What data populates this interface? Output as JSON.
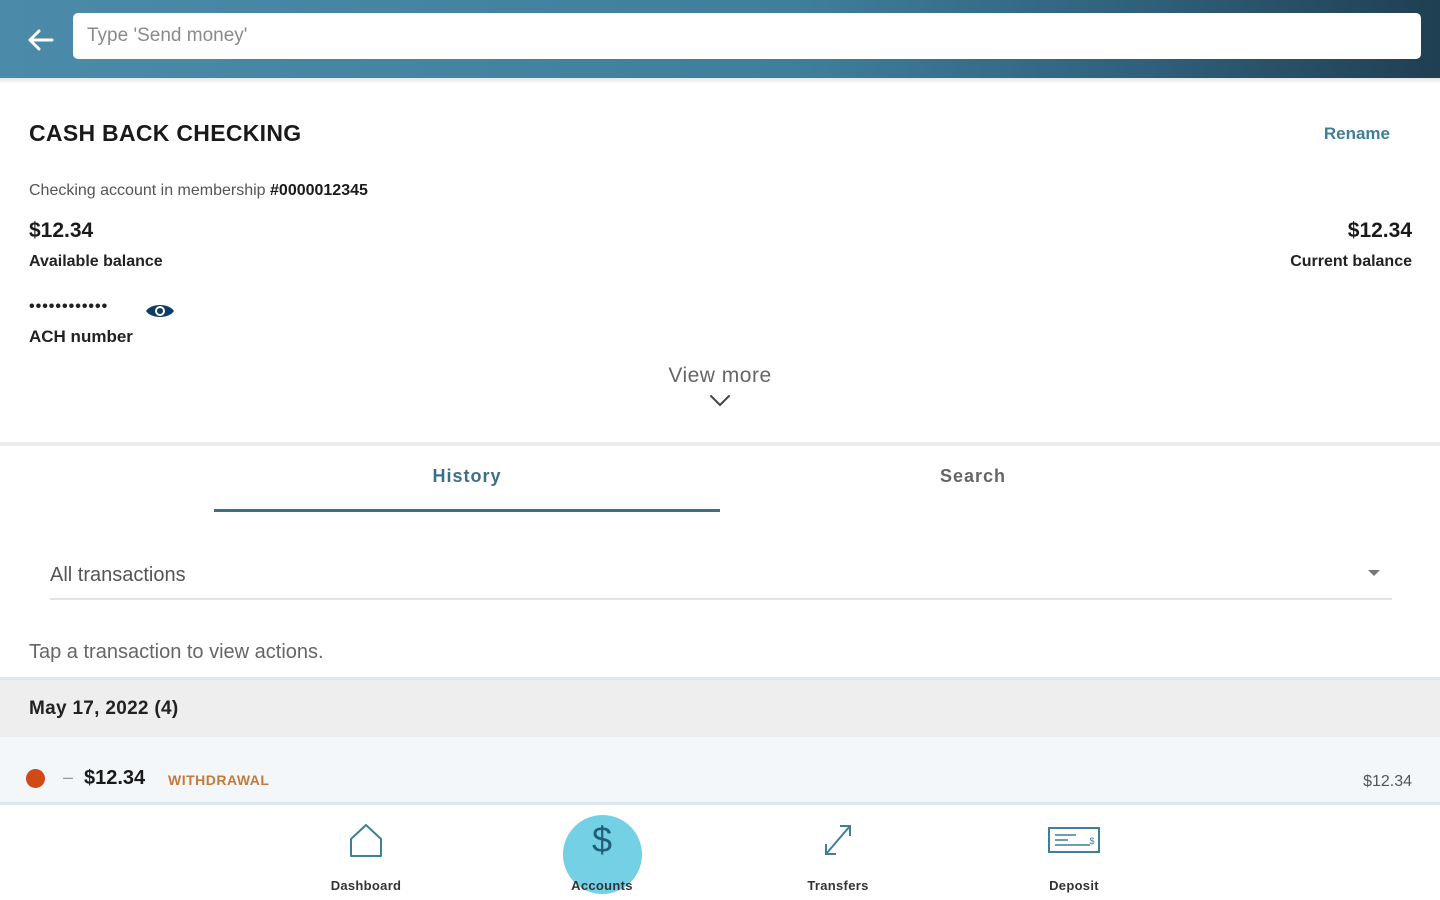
{
  "header": {
    "search_placeholder": "Type 'Send money'"
  },
  "account": {
    "title": "CASH BACK CHECKING",
    "rename_label": "Rename",
    "membership_prefix": "Checking account in membership",
    "membership_number": "#0000012345",
    "available_balance": "$12.34",
    "available_label": "Available balance",
    "current_balance": "$12.34",
    "current_label": "Current balance",
    "ach_masked": "••••••••••••",
    "ach_label": "ACH number",
    "view_more_label": "View more"
  },
  "tabs": [
    {
      "label": "History",
      "active": true
    },
    {
      "label": "Search",
      "active": false
    }
  ],
  "filter": {
    "selected": "All transactions"
  },
  "hint": "Tap a transaction to view actions.",
  "transactions": {
    "groups": [
      {
        "date": "May 17, 2022 (4)",
        "items": [
          {
            "sign": "–",
            "amount": "$12.34",
            "type": "WITHDRAWAL",
            "right_amount": "$12.34",
            "dot_color": "#d04a16"
          }
        ]
      }
    ]
  },
  "bottom_nav": [
    {
      "label": "Dashboard",
      "icon": "home-icon",
      "active": false
    },
    {
      "label": "Accounts",
      "icon": "dollar-icon",
      "active": true
    },
    {
      "label": "Transfers",
      "icon": "transfer-arrows-icon",
      "active": false
    },
    {
      "label": "Deposit",
      "icon": "check-deposit-icon",
      "active": false
    }
  ],
  "colors": {
    "accent": "#3e7f99",
    "active_nav": "#5ac8e0",
    "withdrawal_dot": "#d04a16",
    "withdrawal_text": "#c27a3a"
  }
}
